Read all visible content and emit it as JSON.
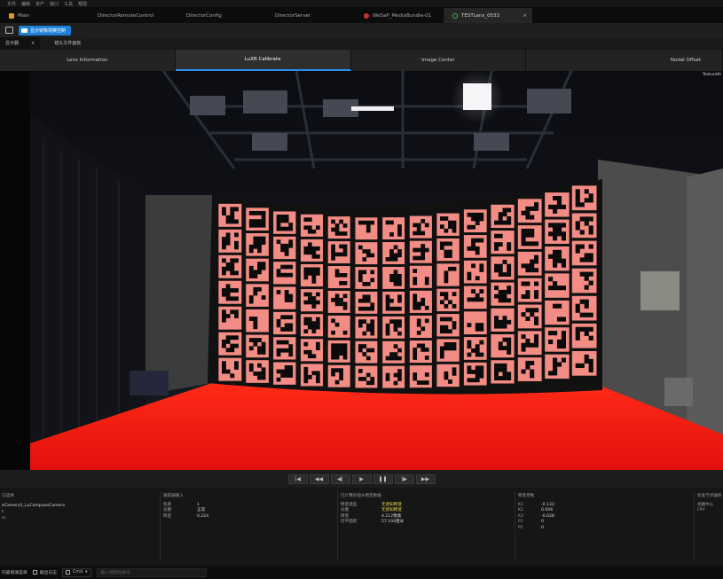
{
  "menu": [
    "文件",
    "编辑",
    "资产",
    "窗口",
    "工具",
    "帮助"
  ],
  "doc_tabs": [
    {
      "label": "Main",
      "icon_color": "#d89a2b",
      "active": false
    },
    {
      "label": "DirectorRemoteControl",
      "icon_color": "",
      "active": false
    },
    {
      "label": "DirectorConfig",
      "icon_color": "",
      "active": false
    },
    {
      "label": "DirectorServer",
      "icon_color": "",
      "active": false
    },
    {
      "label": "WeSaP_MediaBundle-01",
      "icon_color": "#c93131",
      "active": false
    },
    {
      "label": "TESTLens_0533",
      "icon_color": "#2fbf59",
      "active": true
    }
  ],
  "toolbar": {
    "button_label": "显示镜像观察控制"
  },
  "panel_tabs": {
    "first": "显示器",
    "second": "镜头文件面板"
  },
  "subtabs": [
    "Lens Information",
    "LuXR Calibrate",
    "Image Center",
    "Nodal Offset"
  ],
  "viewport": {
    "corner_label": "Textureth",
    "wall_grid": {
      "rows": 7,
      "cols": 14
    }
  },
  "transport": [
    "|◀",
    "◀◀",
    "◀|",
    "▶",
    "❚❚",
    "|▶",
    "▶▶"
  ],
  "info": {
    "col1": {
      "title": "已选择",
      "lines": [
        "eCamera1_LuComposeCamera",
        "t",
        "rs"
      ]
    },
    "col2": {
      "title": "跟踪器输入",
      "rows": [
        [
          "焦距",
          "1"
        ],
        [
          "光圈",
          "正常"
        ],
        [
          "畸变",
          "0.224"
        ]
      ]
    },
    "col3": {
      "title": "已计算的镜头畸变数据",
      "rows": [
        [
          "畸变类型",
          "无感知畸变",
          "y"
        ],
        [
          "光圈",
          "无感知畸变",
          "y"
        ],
        [
          "畸变",
          "4.212像素",
          ""
        ],
        [
          "近平面距",
          "57.104厘米",
          ""
        ]
      ]
    },
    "col4": {
      "title": "畸变参数",
      "rows": [
        [
          "K1",
          "-0.133"
        ],
        [
          "K2",
          "0.006"
        ],
        [
          "K3",
          "-0.028"
        ],
        [
          "P1",
          "0"
        ],
        [
          "P2",
          "0"
        ]
      ]
    },
    "col5": {
      "title": "标准节点偏移",
      "rows": [
        [
          "视图中心",
          ""
        ],
        [
          "FPV",
          ""
        ]
      ]
    }
  },
  "statusbar": {
    "content_drawer": "内容侧滑菜单",
    "output_log": "输出日志",
    "cmd": "Cmd",
    "cmd_placeholder": "输入控制台命令"
  },
  "colors": {
    "accent": "#2d8ee8",
    "floor": "#e8120f",
    "marker_bg": "#f28c84",
    "warning_text": "#e7d44a"
  }
}
